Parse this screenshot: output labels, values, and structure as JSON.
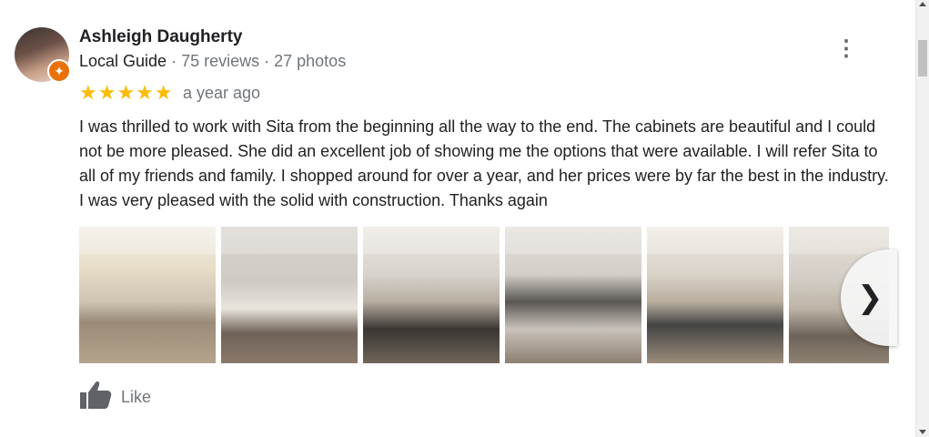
{
  "reviewer": {
    "name": "Ashleigh Daugherty",
    "badge_label": "Local Guide",
    "reviews_count": "75 reviews",
    "photos_count": "27 photos",
    "separator": " · "
  },
  "review": {
    "stars_display": "★★★★★",
    "rating": 5,
    "time": "a year ago",
    "text": "I was thrilled to work with Sita from the beginning all the way to the end. The cabinets are beautiful and I could not be more pleased. She did an excellent job of showing me the options that were available. I will refer Sita to all of my friends and family. I shopped around for over a year, and her prices were by far the best in the industry. I was very pleased with the solid with construction. Thanks again"
  },
  "icons": {
    "more": "more-vert-icon",
    "next": "chevron-right-icon",
    "like": "thumb-up-icon",
    "guide_badge": "local-guide-star-icon",
    "more_glyph": "⋮",
    "next_glyph": "❯",
    "badge_glyph": "✦"
  },
  "actions": {
    "like_label": "Like"
  },
  "colors": {
    "star": "#fbbc04",
    "muted_text": "#70757a",
    "badge": "#e8710a"
  }
}
